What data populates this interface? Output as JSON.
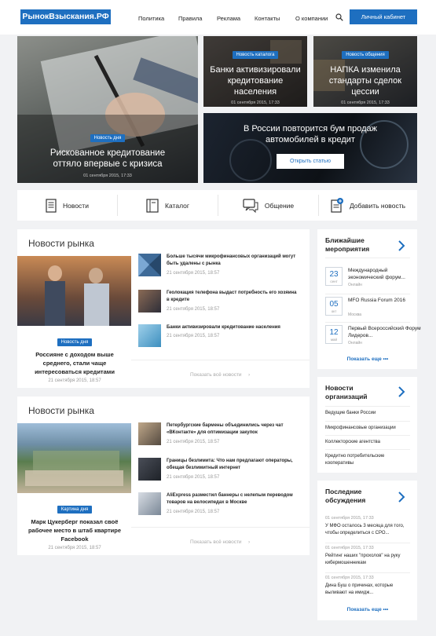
{
  "header": {
    "logo": "РынокВзыскания.РФ",
    "nav": [
      "Политика",
      "Правила",
      "Реклама",
      "Контакты",
      "О компании"
    ],
    "cabinet_button": "Личный кабинет"
  },
  "hero": {
    "main": {
      "badge": "Новость дня",
      "title": "Рискованное кредитование оттяло впервые с кризиса",
      "date": "01 сентября 2015, 17:33"
    },
    "tile1": {
      "badge": "Новость каталога",
      "title": "Банки активизировали кредитование населения",
      "date": "01 сентября 2015, 17:33"
    },
    "tile2": {
      "badge": "Новость общения",
      "title": "НАПКА изменила стандарты сделок цессии",
      "date": "01 сентября 2015, 17:33"
    },
    "wide": {
      "title": "В России повторится бум продаж автомобилей в кредит",
      "button": "Открыть статью"
    }
  },
  "categories": [
    "Новости",
    "Каталог",
    "Общение",
    "Добавить новость"
  ],
  "market1": {
    "title": "Новости рынка",
    "lead": {
      "badge": "Новость дня",
      "title": "Россияне с доходом выше среднего, стали чаще интересоваться кредитами",
      "date": "21 сентября 2015, 18:57"
    },
    "items": [
      {
        "title": "Больше тысячи микрофинансовых организаций могут быть удалены с рынка",
        "date": "21 сентября 2015, 18:57"
      },
      {
        "title": "Геолокация телефона выдаст потребность его хозяина в кредите",
        "date": "21 сентября 2015, 18:57"
      },
      {
        "title": "Банки активизировали кредитование населения",
        "date": "21 сентября 2015, 18:57"
      }
    ],
    "more": "Показать всё новости"
  },
  "market2": {
    "title": "Новости рынка",
    "lead": {
      "badge": "Картина дня",
      "title": "Марк Цукерберг показал своё рабочее место в штаб квартире Facebook",
      "date": "21 сентября 2015, 18:57"
    },
    "items": [
      {
        "title": "Петербургские бармены объединились через чат «ВКонтакте» для оптимизации закупок",
        "date": "21 сентября 2015, 18:57"
      },
      {
        "title": "Границы безлимита: Что нам предлагают операторы, обещая безлимитный интернет",
        "date": "21 сентября 2015, 18:57"
      },
      {
        "title": "AliExpress разместил баннеры с нелепым переводом товаров на велосипедах в Москве",
        "date": "21 сентября 2015, 18:57"
      }
    ],
    "more": "Показать всё новости"
  },
  "events": {
    "title": "Ближайшие мероприятия",
    "items": [
      {
        "day": "23",
        "month": "сент",
        "title": "Международный экономический форум...",
        "place": "Онлайн"
      },
      {
        "day": "05",
        "month": "окт",
        "title": "MFO Russia Forum 2016",
        "place": "Москва"
      },
      {
        "day": "12",
        "month": "май",
        "title": "Первый Всероссийский Форум Лидеров...",
        "place": "Онлайн"
      }
    ],
    "more": "Показать еще"
  },
  "orgs": {
    "title": "Новости организаций",
    "items": [
      "Ведущие банки России",
      "Микрофинансовые организации",
      "Коллекторские агентства",
      "Кредитно потребительские кооперативы"
    ]
  },
  "discussions": {
    "title": "Последние обсуждения",
    "items": [
      {
        "date": "01 сентября 2015, 17:33",
        "text": "У МФО осталось 3 месяца для того, чтобы определиться с СРО..."
      },
      {
        "date": "01 сентября 2015, 17:33",
        "text": "Рейтинг наших \"прохолов\" на руку кибермошенникам"
      },
      {
        "date": "01 сентября 2015, 17:33",
        "text": "Дина Буш о причинах, которые выливают на имидж..."
      }
    ],
    "more": "Показать еще"
  },
  "colors": {
    "accent": "#1e6fc0",
    "background": "#f1f2f4"
  }
}
